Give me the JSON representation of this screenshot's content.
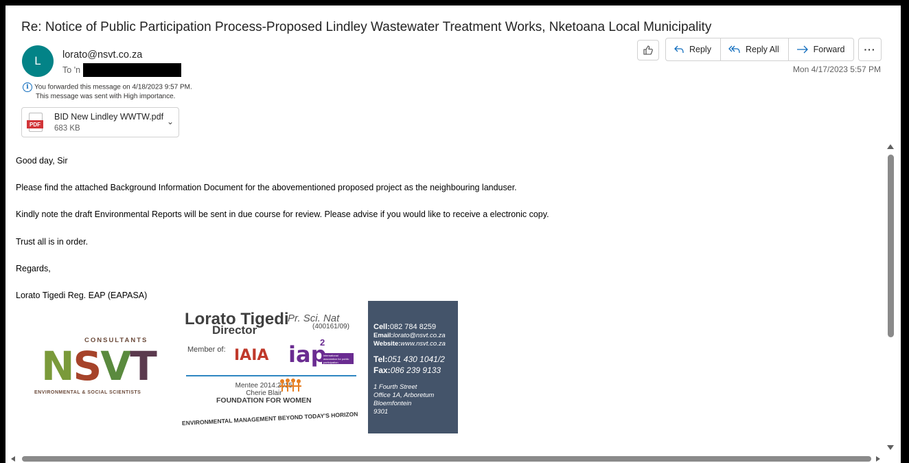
{
  "message": {
    "subject": "Re: Notice of Public Participation Process-Proposed Lindley Wastewater Treatment Works, Nketoana Local Municipality",
    "avatar_initial": "L",
    "avatar_color": "#038387",
    "sender": "lorato@nsvt.co.za",
    "to_label": "To",
    "to_value": "'n",
    "date": "Mon 4/17/2023 5:57 PM",
    "info_lines": [
      "You forwarded this message on 4/18/2023 9:57 PM.",
      "This message was sent with High importance."
    ]
  },
  "attachment": {
    "type_label": "PDF",
    "name": "BID New Lindley WWTW.pdf",
    "size": "683 KB"
  },
  "actions": {
    "reply": "Reply",
    "reply_all": "Reply All",
    "forward": "Forward",
    "more": "···"
  },
  "body": {
    "paragraphs": [
      "Good day, Sir",
      "Please find the attached Background Information Document for the abovementioned proposed project as the neighbouring landuser.",
      "Kindly note the draft Environmental Reports will be sent in due course for review. Please advise if you would like to receive a electronic copy.",
      "Trust all is in order.",
      "Regards,",
      "Lorato Tigedi Reg. EAP (EAPASA)"
    ]
  },
  "signature": {
    "logo": {
      "top_text": "CONSULTANTS",
      "letters": [
        "N",
        "S",
        "V",
        "T"
      ],
      "letter_colors": [
        "#7a9a3a",
        "#a6432a",
        "#5a8a3e",
        "#5b3a4e"
      ],
      "bottom_text": "ENVIRONMENTAL & SOCIAL SCIENTISTS"
    },
    "card": {
      "name": "Lorato Tigedi",
      "title": "Pr. Sci. Nat",
      "role": "Director",
      "reg_no": "(400161/09)",
      "member_of": "Member of:",
      "iaia": "IAIA",
      "iap": "iap",
      "iap_sup": "2",
      "iap_small": "international association for public participation SOUTHERN AFRICA",
      "mentee_line1": "Mentee 2014:2015",
      "mentee_line2": "Cherie Blair",
      "mentee_line3": "FOUNDATION FOR WOMEN",
      "slogan": "ENVIRONMENTAL MANAGEMENT BEYOND TODAY'S HORIZON"
    },
    "contact": {
      "cell_label": "Cell:",
      "cell": "082 784 8259",
      "email_label": "Email:",
      "email": "lorato@nsvt.co.za",
      "website_label": "Website:",
      "website": "www.nsvt.co.za",
      "tel_label": "Tel:",
      "tel": "051 430 1041/2",
      "fax_label": "Fax:",
      "fax": "086 239 9133",
      "address": [
        "1 Fourth Street",
        "Office 1A, Arboretum",
        "Bloemfontein",
        "9301"
      ]
    }
  }
}
